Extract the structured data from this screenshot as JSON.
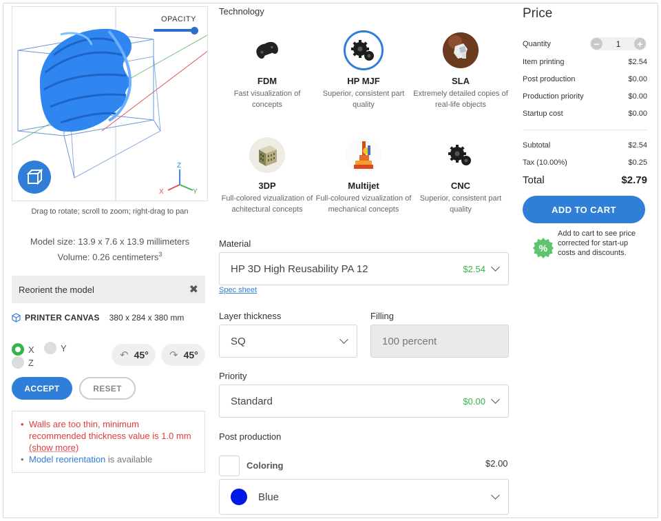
{
  "viewer": {
    "opacity_label": "OPACITY",
    "opacity_value": 1.0,
    "axis_labels": {
      "x": "X",
      "y": "Y",
      "z": "Z"
    },
    "hint": "Drag to rotate; scroll to zoom; right-drag to pan"
  },
  "model": {
    "size": "Model size: 13.9 x 7.6 x 13.9 millimeters",
    "volume": "Volume: 0.26 centimeters",
    "volume_sup": "3"
  },
  "reorient": {
    "title": "Reorient the model",
    "close_icon": "close-icon",
    "printer_label": "PRINTER CANVAS",
    "printer_dims": "380 x 284 x 380 mm",
    "axes": {
      "x": "X",
      "y": "Y",
      "z": "Z"
    },
    "selected_axis": "X",
    "rotate_left": "45°",
    "rotate_right": "45°",
    "accept": "ACCEPT",
    "reset": "RESET"
  },
  "warnings": {
    "error_text": "Walls are too thin, minimum recommended thickness value is 1.0 mm",
    "show_more": "(show more)",
    "info_link": "Model reorientation",
    "info_text": " is available"
  },
  "technology": {
    "label": "Technology",
    "selected": "HP MJF",
    "items": [
      {
        "name": "FDM",
        "desc": "Fast visualization of concepts",
        "icon": "gamepad-part-icon"
      },
      {
        "name": "HP MJF",
        "desc": "Superior, consistent part quality",
        "icon": "gears-icon"
      },
      {
        "name": "SLA",
        "desc": "Extremely detailed copies of real-life objects",
        "icon": "sla-part-icon"
      },
      {
        "name": "3DP",
        "desc": "Full-colored vizualization of achitectural concepts",
        "icon": "building-model-icon"
      },
      {
        "name": "Multijet",
        "desc": "Full-coloured vizualization of mechanical concepts",
        "icon": "mechanical-model-icon"
      },
      {
        "name": "CNC",
        "desc": "Superior, consistent part quality",
        "icon": "gears-icon"
      }
    ]
  },
  "material": {
    "label": "Material",
    "value": "HP 3D High Reusability PA 12",
    "price": "$2.54",
    "spec_sheet": "Spec sheet"
  },
  "layer": {
    "label": "Layer thickness",
    "value": "SQ"
  },
  "filling": {
    "label": "Filling",
    "value": "100 percent"
  },
  "priority": {
    "label": "Priority",
    "value": "Standard",
    "price": "$0.00"
  },
  "post_production": {
    "label": "Post production",
    "coloring_label": "Coloring",
    "coloring_price": "$2.00",
    "color_value": "Blue",
    "color_hex": "#0019e6"
  },
  "price": {
    "title": "Price",
    "quantity_label": "Quantity",
    "quantity": "1",
    "rows": [
      {
        "label": "Item printing",
        "value": "$2.54"
      },
      {
        "label": "Post production",
        "value": "$0.00"
      },
      {
        "label": "Production priority",
        "value": "$0.00"
      },
      {
        "label": "Startup cost",
        "value": "$0.00"
      }
    ],
    "subtotal_label": "Subtotal",
    "subtotal": "$2.54",
    "tax_label": "Tax (10.00%)",
    "tax": "$0.25",
    "total_label": "Total",
    "total": "$2.79",
    "add_to_cart": "ADD TO CART",
    "note": "Add to cart to see price corrected for start-up costs and discounts.",
    "badge": "%"
  },
  "colors": {
    "accent": "#2f7ed8",
    "success": "#36b34a",
    "error": "#e33b3b"
  }
}
